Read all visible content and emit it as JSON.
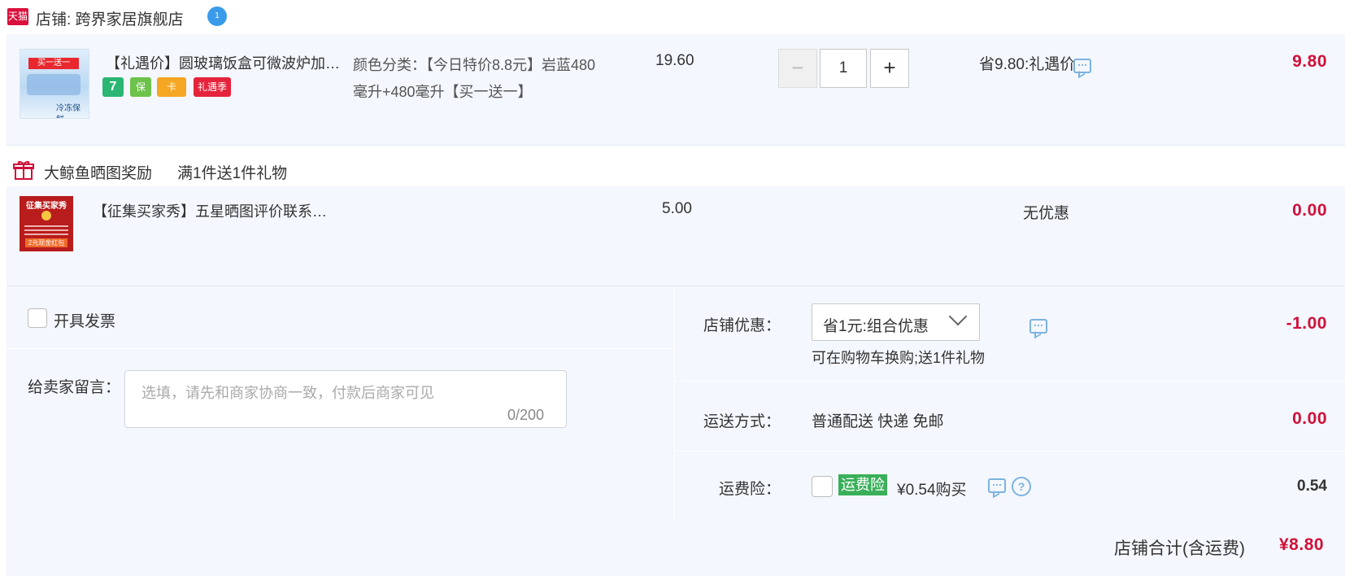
{
  "shop": {
    "badge": "天猫",
    "label": "店铺:",
    "name": "跨界家居旗舰店",
    "chat_badge": "1"
  },
  "items": [
    {
      "thumb_text_top": "买一送一",
      "thumb_text_bottom": "冷冻保鲜",
      "title": "【礼遇价】圆玻璃饭盒可微波炉加热专用",
      "tags": [
        "7",
        "保",
        "卡",
        "礼遇季"
      ],
      "sku": "颜色分类：【今日特价8.8元】岩蓝480毫升+480毫升【买一送一】",
      "unit_price": "19.60",
      "quantity": "1",
      "promo": "省9.80:礼遇价",
      "total": "9.80"
    },
    {
      "thumb_text_top": "征集买家秀",
      "thumb_text_bottom": "2元现金红包",
      "title": "【征集买家秀】五星晒图评价联系客服",
      "unit_price": "5.00",
      "promo": "无优惠",
      "total": "0.00"
    }
  ],
  "gift": {
    "label": "大鲸鱼晒图奖励",
    "rule": "满1件送1件礼物"
  },
  "invoice": {
    "label": "开具发票"
  },
  "note": {
    "label": "给卖家留言：",
    "placeholder": "选填，请先和商家协商一致，付款后商家可见",
    "count": "0/200"
  },
  "discount": {
    "label": "店铺优惠：",
    "selected": "省1元:组合优惠",
    "note": "可在购物车换购;送1件礼物",
    "amount": "-1.00"
  },
  "shipping": {
    "label": "运送方式：",
    "value": "普通配送 快递 免邮",
    "amount": "0.00"
  },
  "insurance": {
    "label": "运费险：",
    "badge": "运费险",
    "price": "¥0.54购买",
    "help": "?",
    "amount": "0.54"
  },
  "shop_total": {
    "label": "店铺合计(含运费)",
    "amount": "¥8.80"
  },
  "colors": {
    "price_red": "#d0103a",
    "row_bg": "#f4f7fd",
    "tmall_red": "#d9103c",
    "insurance_green": "#3aaf5a",
    "icon_blue": "#7bb3e0"
  }
}
